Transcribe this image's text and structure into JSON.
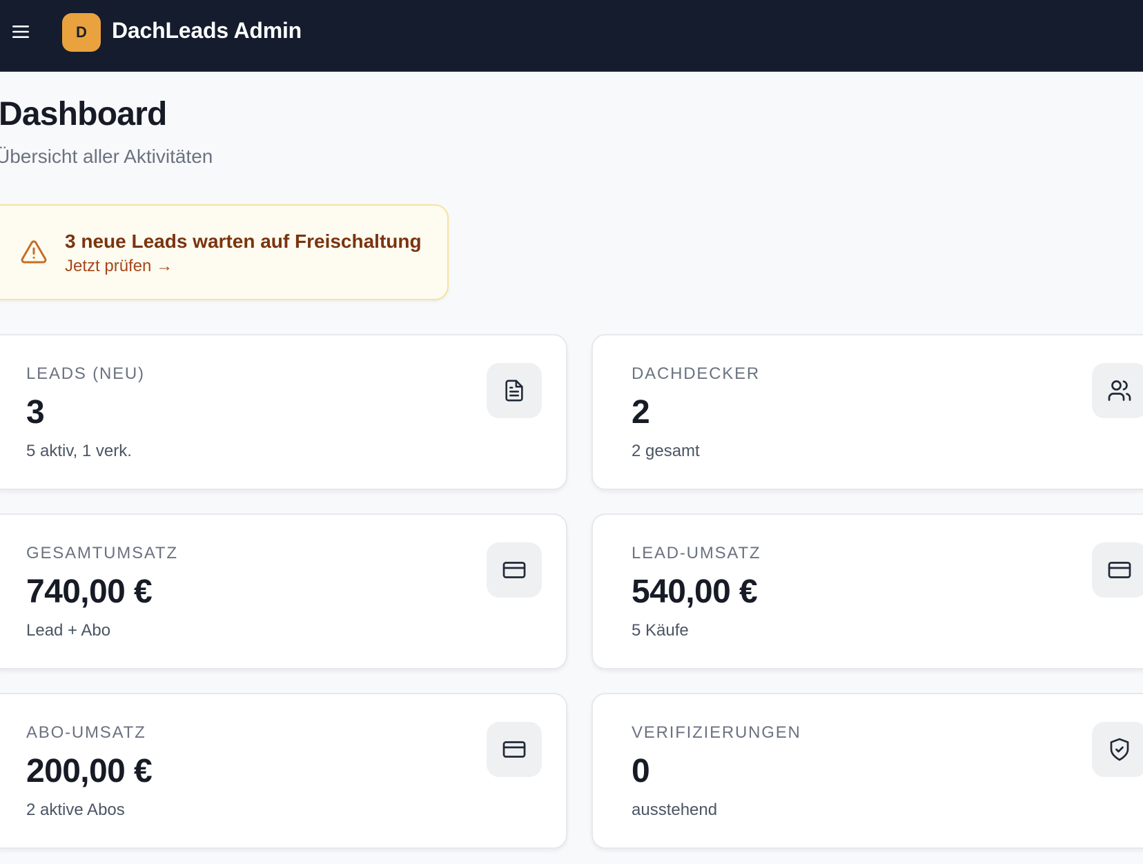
{
  "header": {
    "logo_letter": "D",
    "app_title": "DachLeads Admin",
    "menu_icon": "menu-icon"
  },
  "page": {
    "title": "Dashboard",
    "subtitle": "Übersicht aller Aktivitäten"
  },
  "alert": {
    "icon": "warning-triangle-icon",
    "title": "3 neue Leads warten auf Freischaltung",
    "link": "Jetzt prüfen →"
  },
  "stats": [
    {
      "label": "Leads (neu)",
      "value": "3",
      "sub": "5 aktiv, 1 verk.",
      "icon": "document-icon"
    },
    {
      "label": "Dachdecker",
      "value": "2",
      "sub": "2 gesamt",
      "icon": "users-icon"
    },
    {
      "label": "Gesamtumsatz",
      "value": "740,00 €",
      "sub": "Lead + Abo",
      "icon": "credit-card-icon"
    },
    {
      "label": "Lead-Umsatz",
      "value": "540,00 €",
      "sub": "5 Käufe",
      "icon": "credit-card-icon"
    },
    {
      "label": "Abo-Umsatz",
      "value": "200,00 €",
      "sub": "2 aktive Abos",
      "icon": "credit-card-icon"
    },
    {
      "label": "Verifizierungen",
      "value": "0",
      "sub": "ausstehend",
      "icon": "shield-check-icon"
    }
  ],
  "colors": {
    "topbar": "#141c2e",
    "logo": "#eaa23e",
    "alert_bg": "#fefcf0",
    "alert_border": "#f6e3a0",
    "alert_text": "#7a3410"
  }
}
